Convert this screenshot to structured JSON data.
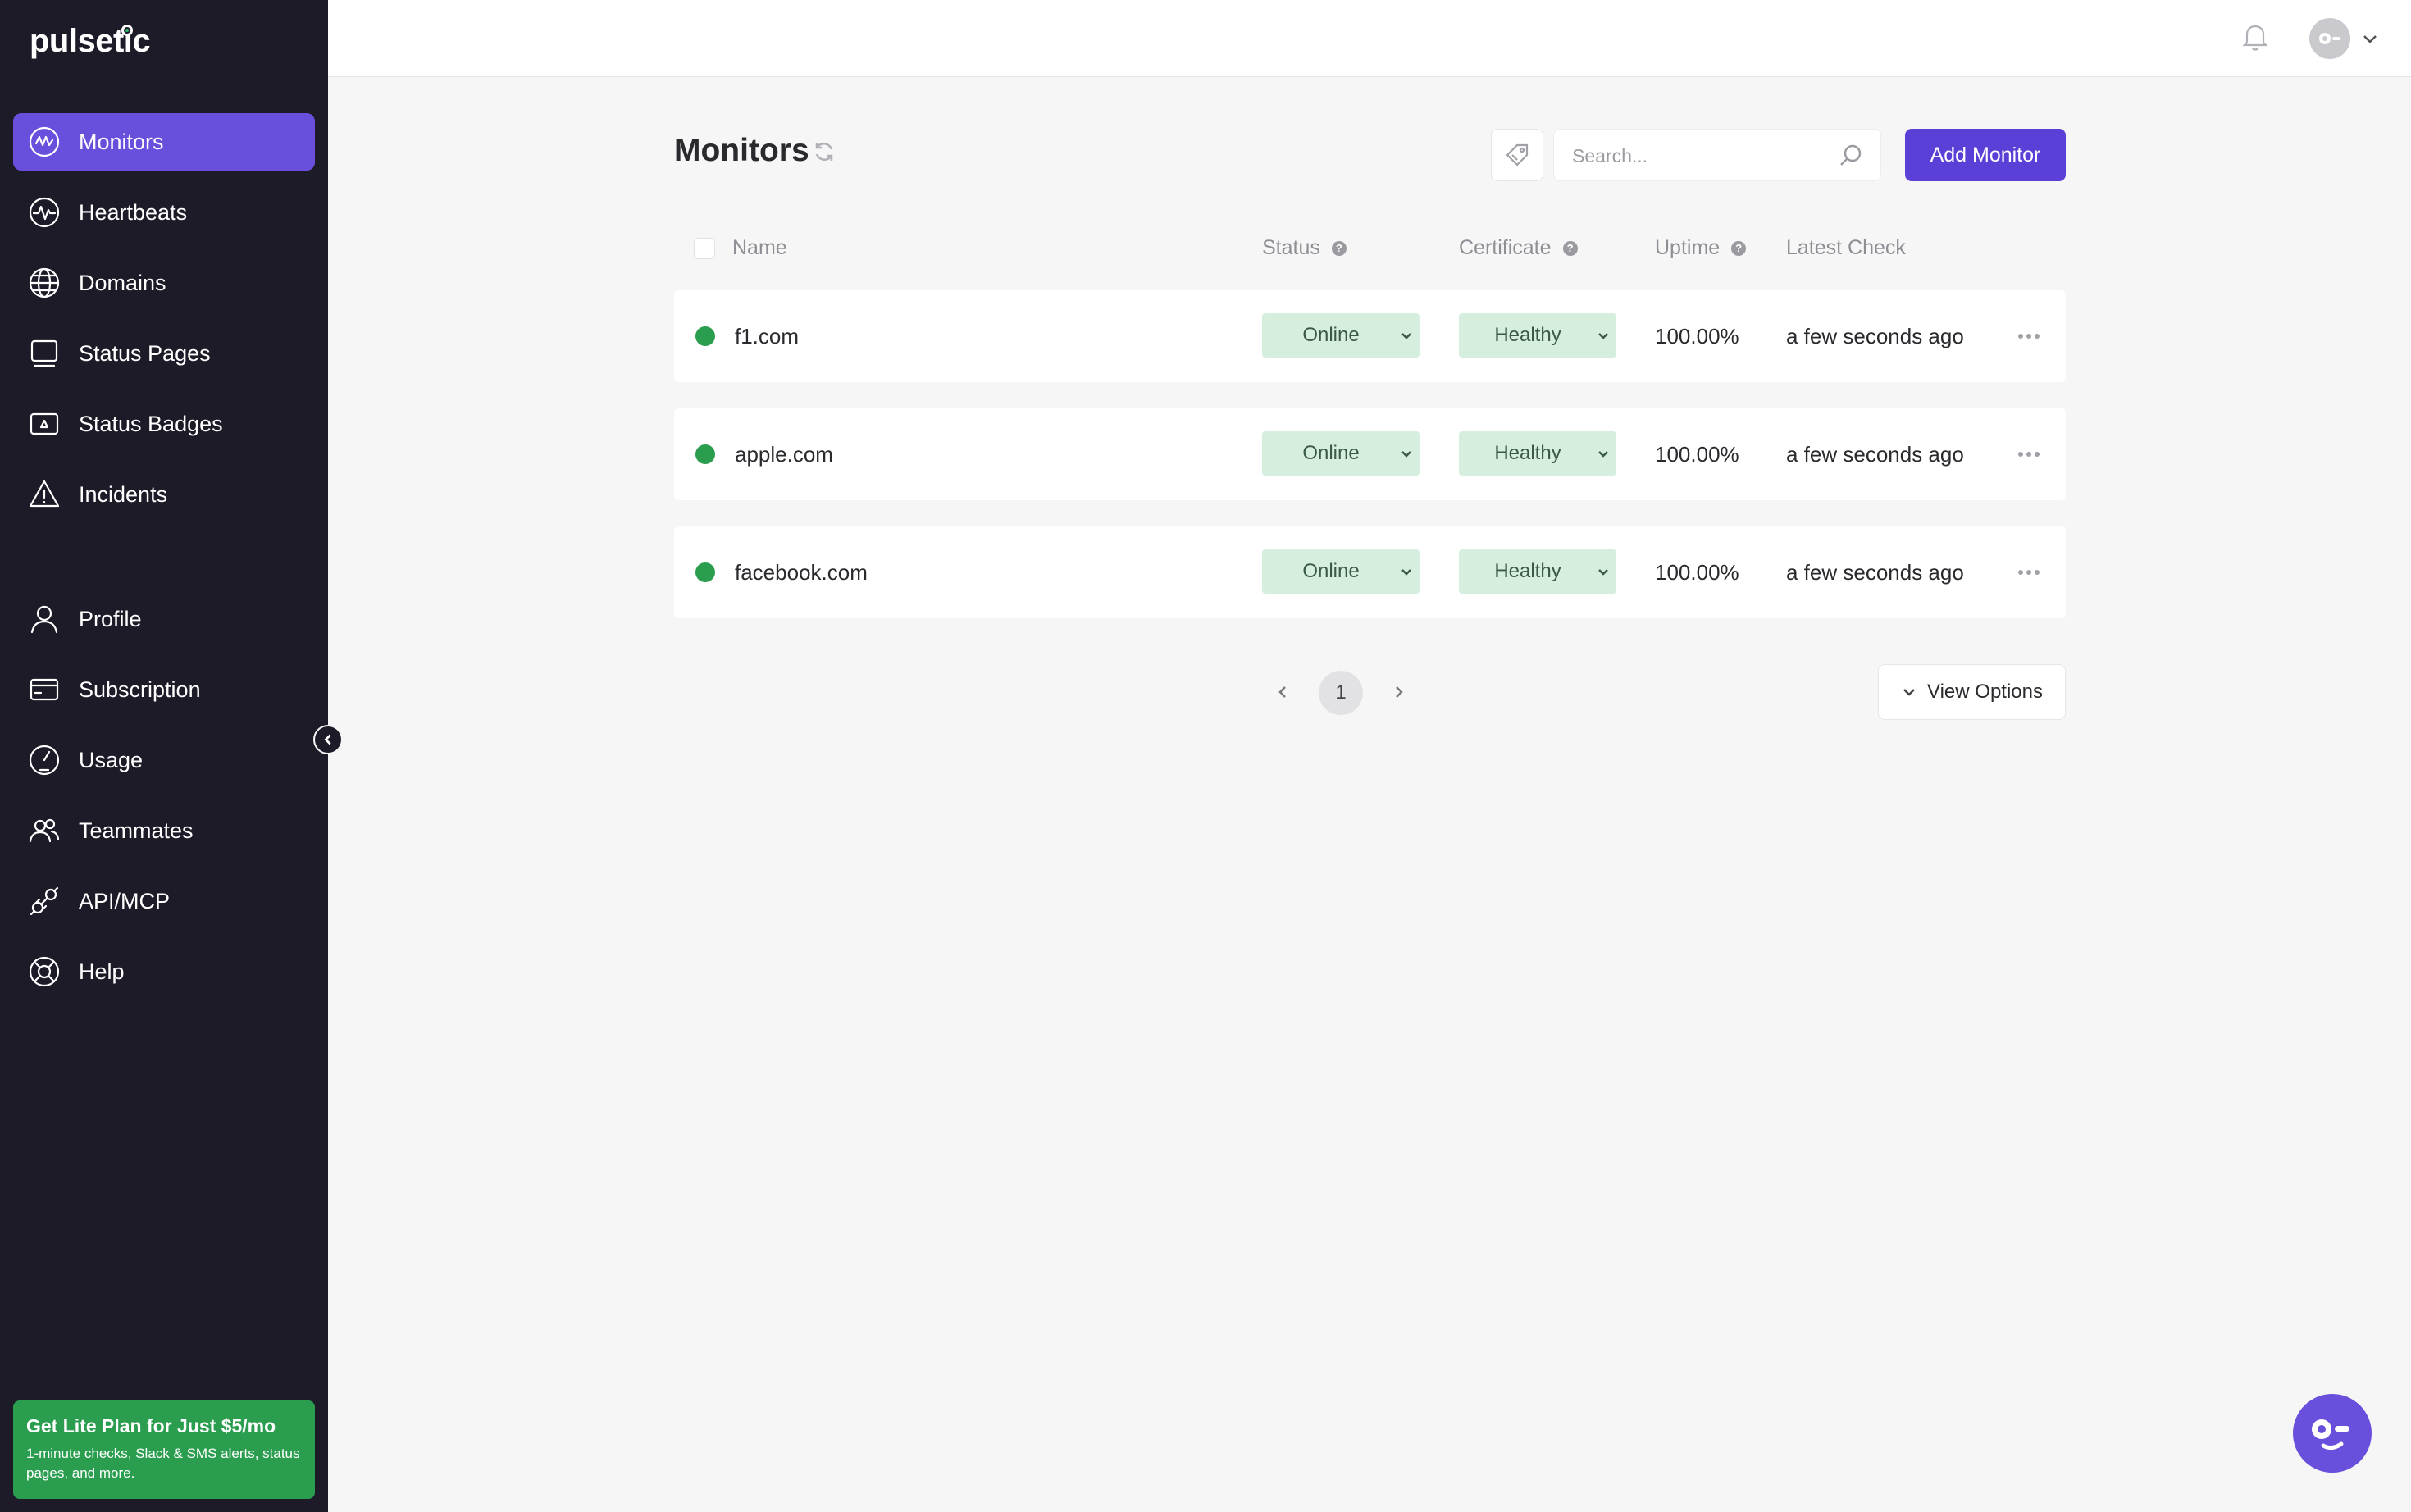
{
  "app": {
    "logo": "pulsetic"
  },
  "sidebar": {
    "items": [
      {
        "label": "Monitors",
        "icon": "monitor-wave-icon",
        "active": true
      },
      {
        "label": "Heartbeats",
        "icon": "heartbeat-icon"
      },
      {
        "label": "Domains",
        "icon": "globe-icon"
      },
      {
        "label": "Status Pages",
        "icon": "screen-icon"
      },
      {
        "label": "Status Badges",
        "icon": "badge-icon"
      },
      {
        "label": "Incidents",
        "icon": "warning-icon"
      },
      {
        "label": "Profile",
        "icon": "user-icon"
      },
      {
        "label": "Subscription",
        "icon": "card-icon"
      },
      {
        "label": "Usage",
        "icon": "gauge-icon"
      },
      {
        "label": "Teammates",
        "icon": "team-icon"
      },
      {
        "label": "API/MCP",
        "icon": "plug-icon"
      },
      {
        "label": "Help",
        "icon": "lifebuoy-icon"
      }
    ],
    "promo": {
      "title": "Get Lite Plan for Just $5/mo",
      "text": "1-minute checks, Slack & SMS alerts, status pages, and more."
    }
  },
  "header": {
    "title": "Monitors",
    "search_placeholder": "Search...",
    "add_label": "Add Monitor"
  },
  "table": {
    "columns": {
      "name": "Name",
      "status": "Status",
      "certificate": "Certificate",
      "uptime": "Uptime",
      "latest": "Latest Check"
    },
    "rows": [
      {
        "name": "f1.com",
        "status": "Online",
        "certificate": "Healthy",
        "uptime": "100.00%",
        "latest": "a few seconds ago"
      },
      {
        "name": "apple.com",
        "status": "Online",
        "certificate": "Healthy",
        "uptime": "100.00%",
        "latest": "a few seconds ago"
      },
      {
        "name": "facebook.com",
        "status": "Online",
        "certificate": "Healthy",
        "uptime": "100.00%",
        "latest": "a few seconds ago"
      }
    ]
  },
  "pagination": {
    "current": "1"
  },
  "view_options_label": "View Options",
  "colors": {
    "sidebar_bg": "#1d1b27",
    "accent": "#6a4fdc",
    "button": "#5b3fd6",
    "online": "#2a9d4f",
    "pill_bg": "#d5eedd"
  }
}
